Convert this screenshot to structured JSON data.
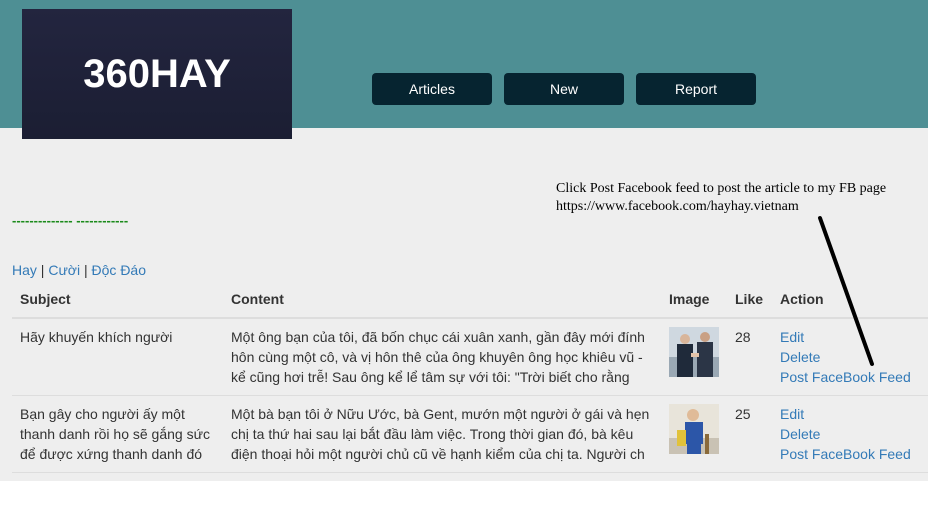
{
  "logo": {
    "text": "360HAY"
  },
  "nav": [
    {
      "label": "Articles"
    },
    {
      "label": "New"
    },
    {
      "label": "Report"
    }
  ],
  "annotation": {
    "text": "Click Post Facebook feed to post the article to my FB page https://www.facebook.com/hayhay.vietnam"
  },
  "dashes": "-------------- ------------",
  "categories": [
    {
      "label": "Hay"
    },
    {
      "label": "Cười"
    },
    {
      "label": "Độc Đáo"
    }
  ],
  "category_separator": "|",
  "table": {
    "headers": {
      "subject": "Subject",
      "content": "Content",
      "image": "Image",
      "like": "Like",
      "action": "Action"
    },
    "rows": [
      {
        "subject": "Hãy khuyến khích người",
        "content": "Một ông bạn của tôi, đã bốn chục cái xuân xanh, gần đây mới đính hôn cùng một cô, và vị hôn thê của ông khuyên ông học khiêu vũ - kể cũng hơi trễ! Sau ông kể lể tâm sự với tôi: \"Trời biết cho rằng",
        "like": "28",
        "actions": {
          "edit": "Edit",
          "delete": "Delete",
          "post": "Post FaceBook Feed"
        }
      },
      {
        "subject": "Bạn gây cho người ấy một thanh danh rồi họ sẽ gắng sức để được xứng thanh danh đó",
        "content": "Một bà bạn tôi ở Nữu Ước, bà Gent, mướn một người ở gái và hẹn chị ta thứ hai sau lại bắt đầu làm việc. Trong thời gian đó, bà kêu điện thoại hỏi một người chủ cũ về hạnh kiểm của chị ta. Người ch",
        "like": "25",
        "actions": {
          "edit": "Edit",
          "delete": "Delete",
          "post": "Post FaceBook Feed"
        }
      }
    ]
  }
}
